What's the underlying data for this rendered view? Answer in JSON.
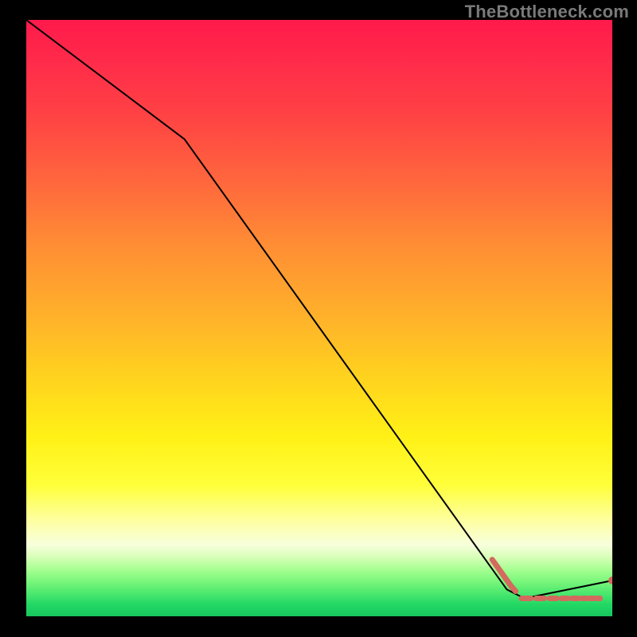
{
  "watermark": "TheBottleneck.com",
  "colors": {
    "line": "#000000",
    "marker": "#d46a5e",
    "background_top": "#ff1a4b",
    "background_bottom": "#18c75e"
  },
  "chart_data": {
    "type": "line",
    "title": "",
    "xlabel": "",
    "ylabel": "",
    "x": [
      0,
      27,
      82,
      85,
      100
    ],
    "values": [
      100,
      80,
      4.5,
      3,
      6
    ],
    "xlim": [
      0,
      100
    ],
    "ylim": [
      0,
      100
    ],
    "highlight_region": {
      "x_start": 80,
      "x_end": 100,
      "description": "near-zero bottleneck zone marked with dashed salmon segments"
    },
    "annotations": []
  }
}
